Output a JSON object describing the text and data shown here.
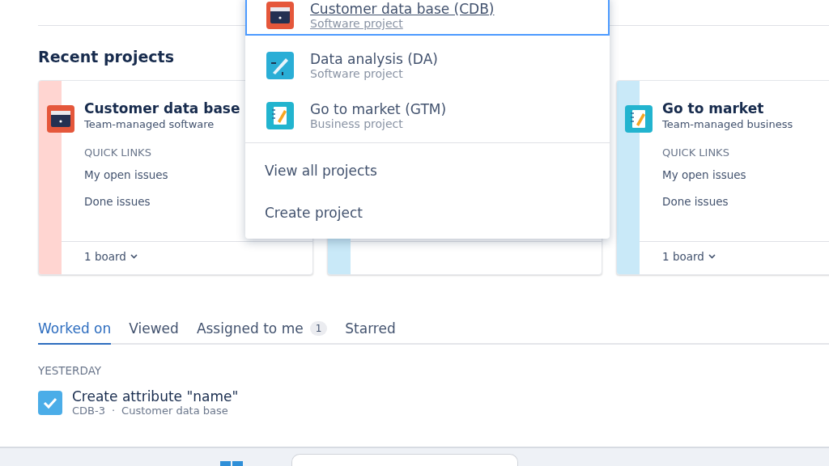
{
  "recent_projects": {
    "title": "Recent projects",
    "cards": [
      {
        "name": "Customer data base",
        "type": "Team-managed software",
        "color": "#ffd5d1",
        "quick_links_label": "QUICK LINKS",
        "links": [
          "My open issues",
          "Done issues"
        ],
        "boards": "1 board"
      },
      {
        "color": "#c9e9f8"
      },
      {
        "name": "Go to market",
        "type": "Team-managed business",
        "color": "#c9e9f8",
        "quick_links_label": "QUICK LINKS",
        "links": [
          "My open issues",
          "Done issues"
        ],
        "boards": "1 board"
      }
    ]
  },
  "projects_menu": {
    "items": [
      {
        "kind": "project",
        "name": "Customer data base (CDB)",
        "type": "Software project",
        "selected": true
      },
      {
        "kind": "project",
        "name": "Data analysis (DA)",
        "type": "Software project",
        "selected": false
      },
      {
        "kind": "project",
        "name": "Go to market (GTM)",
        "type": "Business project",
        "selected": false
      },
      {
        "kind": "action",
        "name": "View all projects",
        "selected": false
      },
      {
        "kind": "action",
        "name": "Create project",
        "selected": false
      }
    ]
  },
  "activity_tabs": [
    {
      "label": "Worked on",
      "selected": true
    },
    {
      "label": "Viewed",
      "selected": false
    },
    {
      "label": "Assigned to me",
      "count": "1",
      "selected": false
    },
    {
      "label": "Starred",
      "selected": false
    }
  ],
  "activity": {
    "group": "YESTERDAY",
    "items": [
      {
        "title": "Create attribute \"name\"",
        "key": "CDB-3",
        "project": "Customer data base",
        "separator": "·"
      }
    ]
  }
}
